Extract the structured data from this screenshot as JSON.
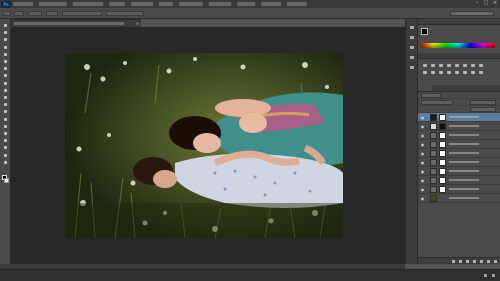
{
  "app": {
    "logo": "Ps"
  },
  "menubar": {
    "items": [
      "",
      "",
      "",
      "",
      "",
      "",
      "",
      "",
      "",
      "",
      ""
    ],
    "window_controls": [
      {
        "icon": "minimize-icon",
        "glyph": "–"
      },
      {
        "icon": "maximize-icon",
        "glyph": "□"
      },
      {
        "icon": "close-icon",
        "glyph": "×"
      }
    ]
  },
  "options_bar": {
    "tool_icon": "move-tool-icon",
    "fields": [
      "",
      "",
      "",
      "",
      ""
    ],
    "workspace": ""
  },
  "document_tab": {
    "title": "",
    "close_glyph": "×"
  },
  "toolbar": {
    "tools": [
      "move-tool-icon",
      "marquee-tool-icon",
      "lasso-tool-icon",
      "quick-select-tool-icon",
      "crop-tool-icon",
      "eyedropper-tool-icon",
      "healing-brush-tool-icon",
      "brush-tool-icon",
      "clone-stamp-tool-icon",
      "history-brush-tool-icon",
      "eraser-tool-icon",
      "gradient-tool-icon",
      "blur-tool-icon",
      "dodge-tool-icon",
      "pen-tool-icon",
      "type-tool-icon",
      "path-selection-tool-icon",
      "shape-tool-icon",
      "hand-tool-icon",
      "zoom-tool-icon"
    ],
    "foreground_color": "#000000",
    "background_color": "#ffffff"
  },
  "right_strip": {
    "icons": [
      "history-icon",
      "actions-icon",
      "properties-icon",
      "info-icon",
      "paragraph-icon"
    ]
  },
  "panels": {
    "color": {
      "title": "",
      "fg": "#000000",
      "bg": "#ffffff"
    },
    "adjustments": {
      "title": "",
      "buttons": 16
    },
    "layers": {
      "tabs": [
        "",
        "",
        ""
      ],
      "active_tab": 0,
      "blend_mode": "",
      "opacity": "",
      "filter": "",
      "fill": "",
      "items": [
        {
          "name": "",
          "thumb": "#1b1b1b",
          "mask": "#ffffff",
          "visible": true,
          "selected": true
        },
        {
          "name": "",
          "thumb": "#d9d9d9",
          "mask": "#111111",
          "visible": true,
          "selected": false
        },
        {
          "name": "",
          "thumb": "#6a6a6a",
          "mask": "#ffffff",
          "visible": true,
          "selected": false
        },
        {
          "name": "",
          "thumb": "#6a6a6a",
          "mask": "#ffffff",
          "visible": true,
          "selected": false
        },
        {
          "name": "",
          "thumb": "#6a6a6a",
          "mask": "#ffffff",
          "visible": true,
          "selected": false
        },
        {
          "name": "",
          "thumb": "#6a6a6a",
          "mask": "#ffffff",
          "visible": true,
          "selected": false
        },
        {
          "name": "",
          "thumb": "#6a6a6a",
          "mask": "#ffffff",
          "visible": true,
          "selected": false
        },
        {
          "name": "",
          "thumb": "#6a6a6a",
          "mask": "#ffffff",
          "visible": true,
          "selected": false
        },
        {
          "name": "",
          "thumb": "#6a6a6a",
          "mask": "#ffffff",
          "visible": true,
          "selected": false
        },
        {
          "name": "",
          "thumb": "#3d4a1c",
          "mask": "",
          "visible": true,
          "selected": false
        }
      ],
      "footer_icons": [
        "link-layers-icon",
        "layer-style-icon",
        "add-mask-icon",
        "adjustment-layer-icon",
        "group-icon",
        "new-layer-icon",
        "delete-layer-icon"
      ]
    }
  },
  "status": {
    "zoom": "",
    "doc_info": ""
  },
  "timeline": {
    "label": ""
  },
  "colors": {
    "panel_bg": "#4a4a4a",
    "selection": "#5d7d9e",
    "canvas_bg": "#282828"
  }
}
